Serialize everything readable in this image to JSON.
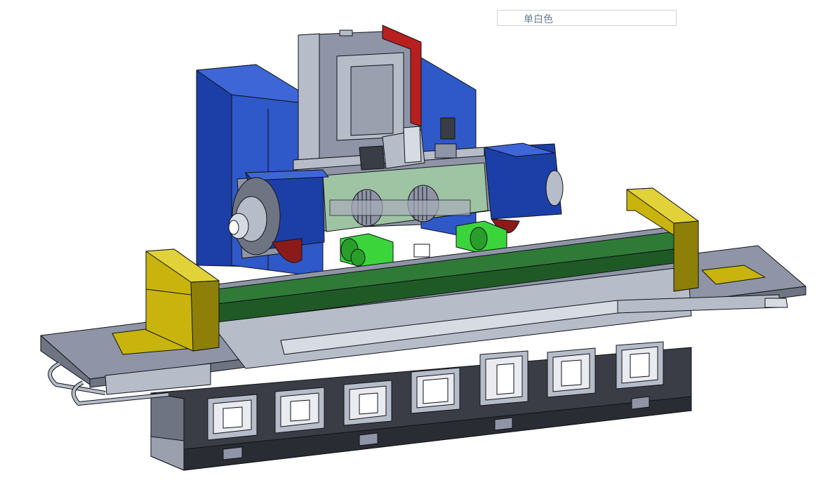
{
  "toolbar": {
    "display_style_label": "单白色"
  },
  "colors": {
    "column_blue": "#1b3fa6",
    "column_blue_light": "#2f58c8",
    "frame_gray": "#8f95a6",
    "frame_gray_light": "#b7bcc9",
    "table_green": "#2f7a37",
    "table_green_dark": "#1f5a26",
    "guard_yellow": "#c8b40c",
    "guard_yellow_dark": "#8d7f08",
    "base_dark": "#3a3d46",
    "motor_green": "#3bd53b",
    "glass_green": "#9fc7a4",
    "accent_red": "#b81f1f",
    "outline": "#111318"
  },
  "icons": [
    "machine-model"
  ]
}
